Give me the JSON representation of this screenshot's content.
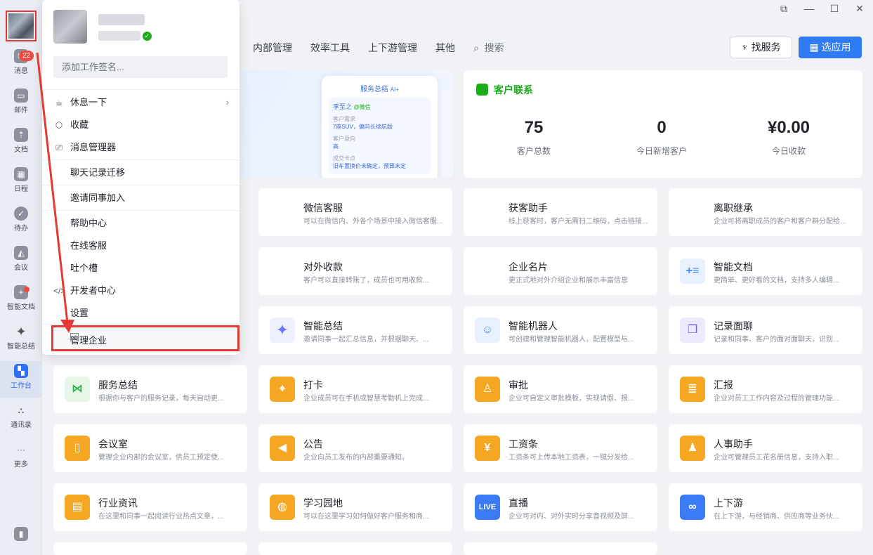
{
  "rail": {
    "items": [
      {
        "label": "消息",
        "icon": "message-icon",
        "badge": "22"
      },
      {
        "label": "邮件",
        "icon": "mail-icon"
      },
      {
        "label": "文档",
        "icon": "doc-icon"
      },
      {
        "label": "日程",
        "icon": "calendar-icon"
      },
      {
        "label": "待办",
        "icon": "todo-icon"
      },
      {
        "label": "会议",
        "icon": "meeting-icon"
      },
      {
        "label": "智能文档",
        "icon": "smart-doc-icon"
      },
      {
        "label": "智能总结",
        "icon": "sparkle-icon"
      },
      {
        "label": "工作台",
        "icon": "workbench-icon",
        "active": true
      },
      {
        "label": "通讯录",
        "icon": "contacts-icon"
      },
      {
        "label": "更多",
        "icon": "more-icon"
      }
    ]
  },
  "topnav": {
    "items": [
      "内部管理",
      "效率工具",
      "上下游管理",
      "其他"
    ],
    "search": "搜索"
  },
  "buttons": {
    "find_service": "找服务",
    "choose_app": "选应用"
  },
  "banner": {
    "title": "服务总结",
    "tag": "AI+",
    "name": "李至之",
    "wechat": "@微信",
    "line1": "客户需求",
    "line2": "7座SUV，偏向长续航版",
    "line3": "客户意向",
    "line4": "高",
    "line5": "成交卡点",
    "line6": "旧车置换价未确定，预算未定"
  },
  "contact": {
    "title": "客户联系",
    "stats": [
      {
        "value": "75",
        "label": "客户总数"
      },
      {
        "value": "0",
        "label": "今日新增客户"
      },
      {
        "value": "¥0.00",
        "label": "今日收款"
      }
    ]
  },
  "apps": [
    {
      "name": "微信客服",
      "desc": "可以在微信内、外各个场景中接入微信客服...",
      "color": "#2bb24c",
      "icon": "chat-bubble-icon"
    },
    {
      "name": "获客助手",
      "desc": "线上获客时，客户无需扫二维码，点击链接...",
      "color": "#2bb24c",
      "icon": "lightning-icon"
    },
    {
      "name": "离职继承",
      "desc": "企业可将离职成员的客户和客户群分配给...",
      "color": "#2bb24c",
      "icon": "transfer-icon"
    },
    {
      "name": "对外收款",
      "desc": "客户可以直接转账了，成员也可用收款...",
      "color": "#2bb24c",
      "icon": "yen-shield-icon"
    },
    {
      "name": "企业名片",
      "desc": "更正式地对外介绍企业和展示丰富信息",
      "color": "#2bb24c",
      "icon": "card-icon"
    },
    {
      "name": "智能文档",
      "desc": "更简单、更好看的文档，支持多人编辑...",
      "color": "#3b8df5",
      "icon": "smart-doc-icon"
    },
    {
      "name": "智能总结",
      "desc": "邀请同事一起汇总信息，并根据聊天、...",
      "color": "#6a7cf5",
      "icon": "sparkle-icon"
    },
    {
      "name": "智能机器人",
      "desc": "可创建和管理智能机器人，配置模型与...",
      "color": "#4b8cf5",
      "icon": "robot-icon"
    },
    {
      "name": "记录面聊",
      "desc": "记录和同事、客户的面对面聊天，识别...",
      "color": "#6a5cf5",
      "icon": "record-icon"
    },
    {
      "name": "服务总结",
      "desc": "根据你与客户的服务记录，每天自动更...",
      "color": "#2bb24c",
      "icon": "bowtie-icon"
    },
    {
      "name": "打卡",
      "desc": "企业成员可在手机或智慧考勤机上完成...",
      "color": "#f5a623",
      "icon": "location-pin-icon"
    },
    {
      "name": "审批",
      "desc": "企业可自定义审批模板，实现请假、报...",
      "color": "#f5a623",
      "icon": "stamp-icon"
    },
    {
      "name": "汇报",
      "desc": "企业对员工工作内容及过程的管理功能...",
      "color": "#f5a623",
      "icon": "report-icon"
    },
    {
      "name": "会议室",
      "desc": "管理企业内部的会议室，供员工预定使...",
      "color": "#f5a623",
      "icon": "door-icon"
    },
    {
      "name": "公告",
      "desc": "企业向员工发布的内部重要通知。",
      "color": "#f5a623",
      "icon": "megaphone-icon"
    },
    {
      "name": "工资条",
      "desc": "工资条可上传本地工资表，一键分发给...",
      "color": "#f5a623",
      "icon": "payslip-icon"
    },
    {
      "name": "人事助手",
      "desc": "企业可管理员工花名册信息，支持入职...",
      "color": "#f5a623",
      "icon": "person-icon"
    },
    {
      "name": "行业资讯",
      "desc": "在这里和同事一起阅读行业热点文章，...",
      "color": "#f5a623",
      "icon": "news-icon"
    },
    {
      "name": "学习园地",
      "desc": "可以在这里学习如何做好客户服务和商...",
      "color": "#f5a623",
      "icon": "planet-icon"
    },
    {
      "name": "直播",
      "desc": "企业可对内、对外实时分享音视频及屏...",
      "color": "#3b7bf5",
      "icon": "live-icon"
    },
    {
      "name": "上下游",
      "desc": "在上下游，与经销商、供应商等业务伙...",
      "color": "#3b7bf5",
      "icon": "link-icon"
    }
  ],
  "popup": {
    "signature_placeholder": "添加工作签名...",
    "items": [
      {
        "label": "休息一下",
        "icon": "coffee-icon",
        "chevron": true
      },
      {
        "label": "收藏",
        "icon": "cube-icon"
      },
      {
        "label": "消息管理器",
        "icon": "message-manager-icon"
      },
      {
        "label": "聊天记录迁移"
      },
      {
        "label": "邀请同事加入"
      },
      {
        "label": "帮助中心"
      },
      {
        "label": "在线客服"
      },
      {
        "label": "吐个槽"
      },
      {
        "label": "开发者中心",
        "icon": "code-icon"
      },
      {
        "label": "设置"
      }
    ],
    "manage": "管理企业"
  }
}
